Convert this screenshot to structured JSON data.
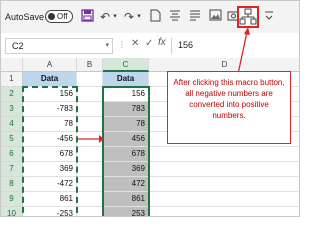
{
  "toolbar": {
    "autosave_label": "AutoSave",
    "autosave_state": "Off",
    "accent_color": "#e02424"
  },
  "formula_bar": {
    "name_box": "C2",
    "formula_value": "156"
  },
  "sheet": {
    "columns": [
      "A",
      "B",
      "C",
      "D"
    ],
    "rows": [
      "1",
      "2",
      "3",
      "4",
      "5",
      "6",
      "7",
      "8",
      "9",
      "10"
    ],
    "col_A_header": "Data",
    "col_C_header": "Data",
    "col_A_values": [
      "156",
      "-783",
      "78",
      "-456",
      "678",
      "369",
      "-472",
      "861",
      "-253"
    ],
    "col_C_values": [
      "156",
      "783",
      "78",
      "456",
      "678",
      "369",
      "472",
      "861",
      "253"
    ],
    "selected_column": "C"
  },
  "callout": {
    "text": "After clicking this macro button, all negative numbers are converted into positive numbers."
  },
  "icons": {
    "save": "save-icon",
    "undo": "undo-icon",
    "redo": "redo-icon",
    "macro": "macro-button-icon"
  }
}
